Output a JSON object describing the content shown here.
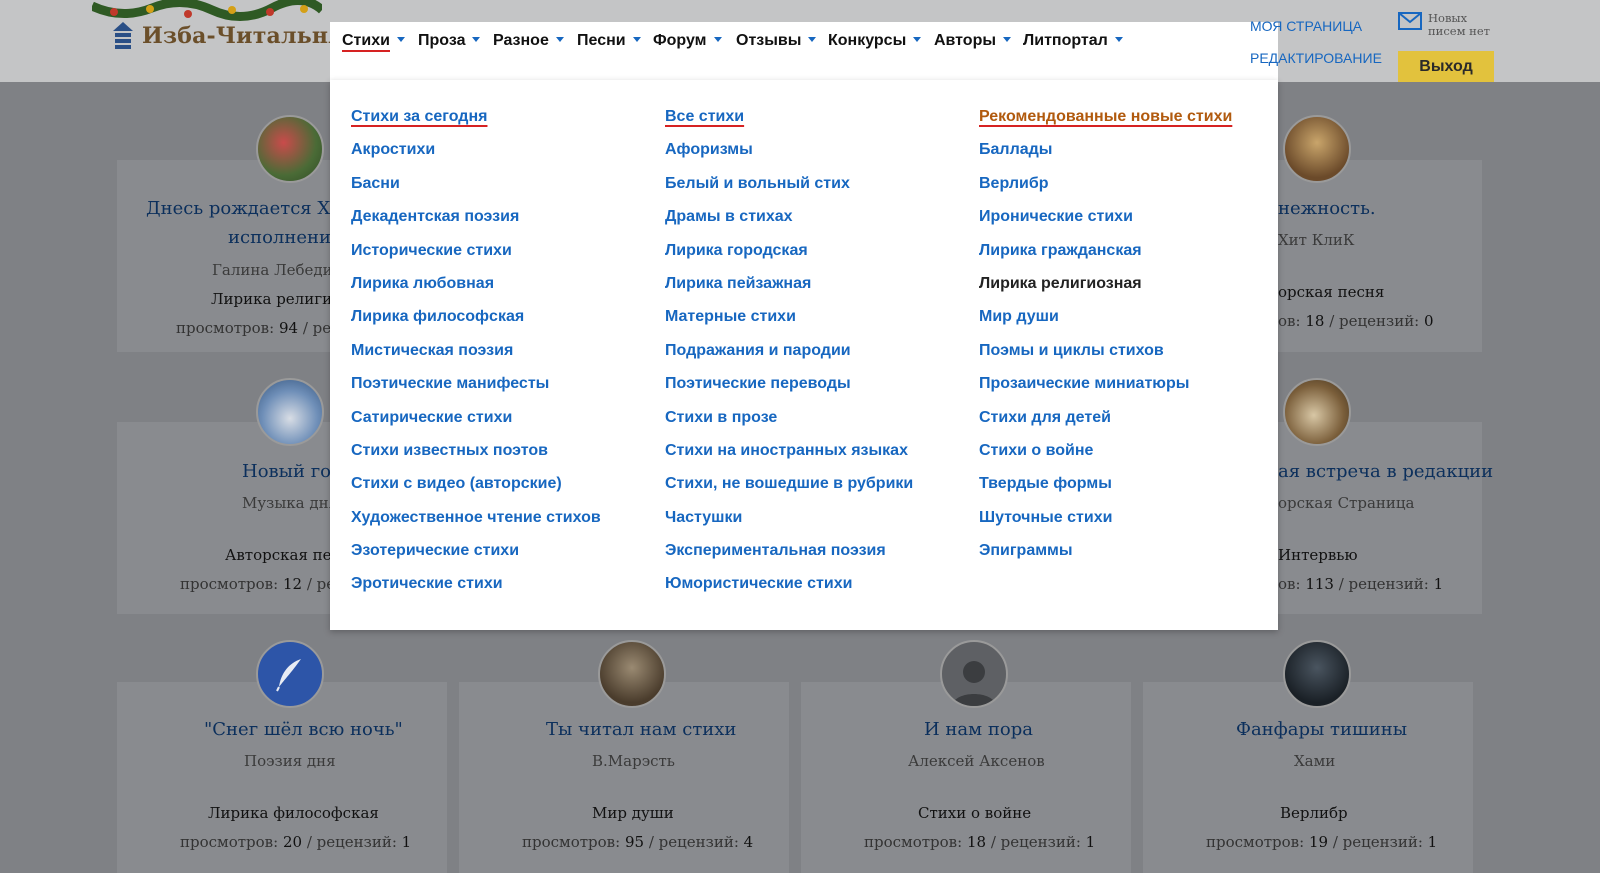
{
  "header": {
    "logo_text": "Изба-Читальня",
    "nav": [
      {
        "label": "Стихи",
        "active": true
      },
      {
        "label": "Проза"
      },
      {
        "label": "Разное"
      },
      {
        "label": "Песни"
      },
      {
        "label": "Форум"
      },
      {
        "label": "Отзывы"
      },
      {
        "label": "Конкурсы"
      },
      {
        "label": "Авторы"
      },
      {
        "label": "Литпортал"
      }
    ],
    "my_page": "МОЯ СТРАНИЦА",
    "edit": "РЕДАКТИРОВАНИЕ",
    "mail_line1": "Новых",
    "mail_line2": "писем нет",
    "logout": "Выход"
  },
  "dropdown": {
    "col1": [
      "Стихи за сегодня",
      "Акростихи",
      "Басни",
      "Декадентская поэзия",
      "Исторические стихи",
      "Лирика любовная",
      "Лирика философская",
      "Мистическая поэзия",
      "Поэтические манифесты",
      "Сатирические стихи",
      "Стихи известных поэтов",
      "Стихи с видео (авторские)",
      "Художественное чтение стихов",
      "Эзотерические стихи",
      "Эротические стихи"
    ],
    "col2": [
      "Все стихи",
      "Афоризмы",
      "Белый и вольный стих",
      "Драмы в стихах",
      "Лирика городская",
      "Лирика пейзажная",
      "Матерные стихи",
      "Подражания и пародии",
      "Поэтические переводы",
      "Стихи в прозе",
      "Стихи на иностранных языках",
      "Стихи, не вошедшие в рубрики",
      "Частушки",
      "Экспериментальная поэзия",
      "Юмористические стихи"
    ],
    "col3": [
      "Рекомендованные новые стихи",
      "Баллады",
      "Верлибр",
      "Иронические стихи",
      "Лирика гражданская",
      "Лирика религиозная",
      "Мир души",
      "Поэмы и циклы стихов",
      "Прозаические миниатюры",
      "Стихи для детей",
      "Стихи о войне",
      "Твердые формы",
      "Шуточные стихи",
      "Эпиграммы"
    ]
  },
  "cards": {
    "r1c1": {
      "title1": "Днесь рождается Хрис",
      "title2": "исполнение.",
      "author": "Галина Лебедина",
      "rubric": "Лирика религиоз",
      "stats_label": "просмотров:",
      "views": "94",
      "tail": "/ рецен"
    },
    "r1c4": {
      "title": "нежность.",
      "author": "Хит КлиК",
      "rubric": "орская песня",
      "stats_pre": "ов:",
      "views": "18",
      "mid": "/ рецензий:",
      "reviews": "0"
    },
    "r2c1": {
      "title": "Новый год",
      "author": "Музыка дня",
      "rubric": "Авторская песн",
      "stats_label": "просмотров:",
      "views": "12",
      "tail": "/ рец"
    },
    "r2c4": {
      "title": "ая встреча в редакции",
      "author": "орская Страница",
      "rubric": "Интервью",
      "stats_pre": "ов:",
      "views": "113",
      "mid": "/ рецензий:",
      "reviews": "1"
    },
    "r3": [
      {
        "title": "\"Снег шёл всю ночь\"",
        "author": "Поэзия дня",
        "rubric": "Лирика философская",
        "stats_label": "просмотров:",
        "views": "20",
        "mid": "/ рецензий:",
        "reviews": "1"
      },
      {
        "title": "Ты читал нам стихи",
        "author": "В.Марэсть",
        "rubric": "Мир души",
        "stats_label": "просмотров:",
        "views": "95",
        "mid": "/ рецензий:",
        "reviews": "4"
      },
      {
        "title": "И нам пора",
        "author": "Алексей Аксенов",
        "rubric": "Стихи о войне",
        "stats_label": "просмотров:",
        "views": "18",
        "mid": "/ рецензий:",
        "reviews": "1"
      },
      {
        "title": "Фанфары тишины",
        "author": "Хами",
        "rubric": "Верлибр",
        "stats_label": "просмотров:",
        "views": "19",
        "mid": "/ рецензий:",
        "reviews": "1"
      }
    ]
  },
  "colors": {
    "link": "#1767c0",
    "active_underline": "#d62222",
    "recommended": "#b15a0e",
    "logout_bg": "#e2c23d",
    "overlay": "#7f8185"
  }
}
